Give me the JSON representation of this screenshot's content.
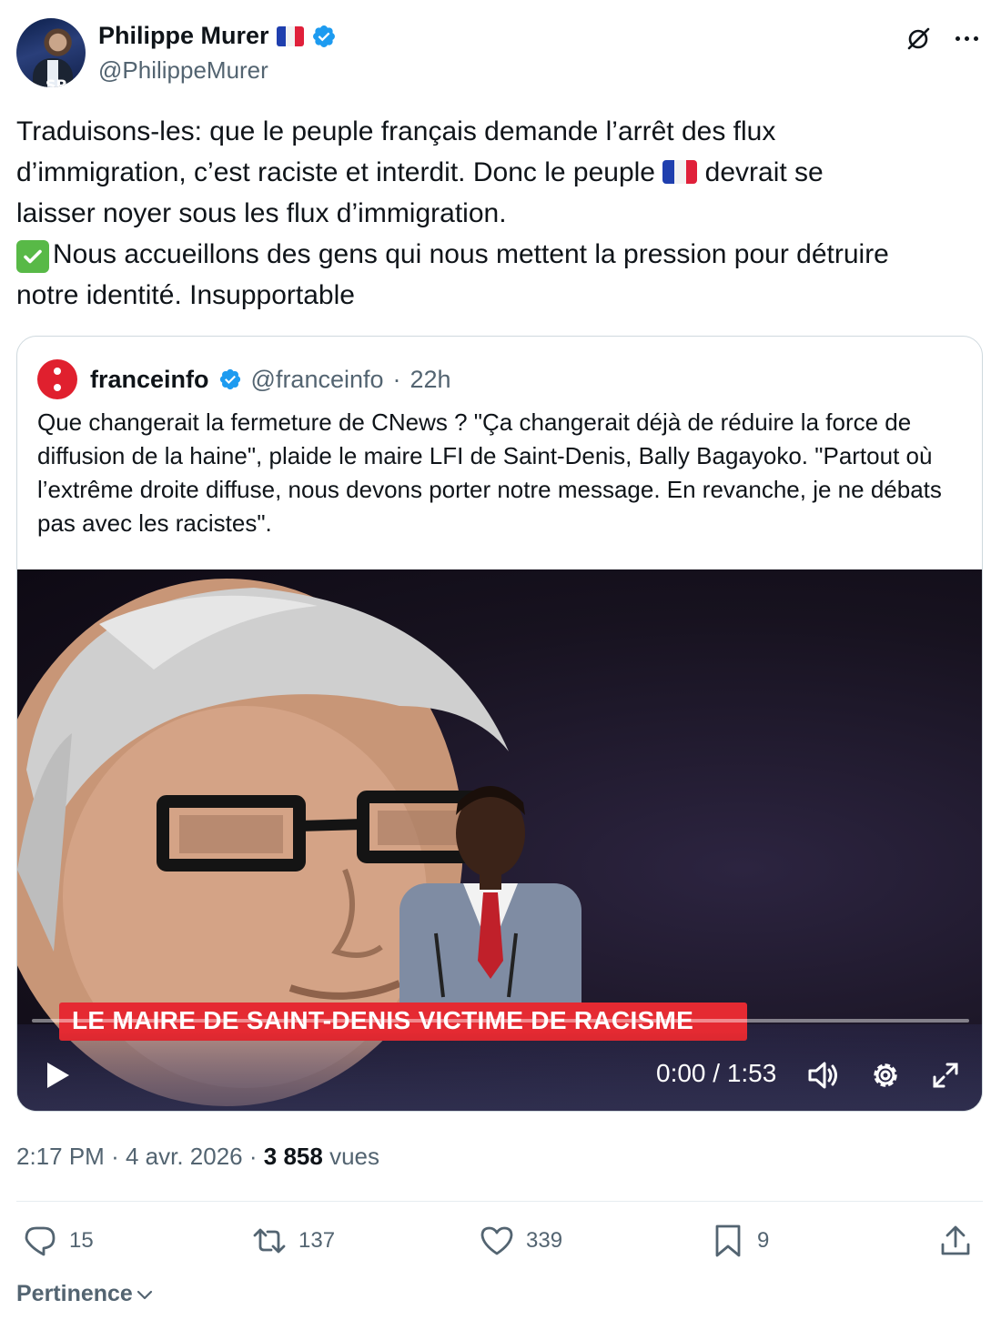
{
  "author": {
    "name": "Philippe Murer",
    "handle": "@PhilippeMurer",
    "avatar_label": "SP",
    "flag": "french-flag-emoji",
    "verified": true
  },
  "tweet": {
    "line1": "Traduisons-les: que le peuple français demande l’arrêt des flux",
    "line2a": "d’immigration, c’est raciste et interdit. Donc le peuple",
    "line2b": "devrait se",
    "line3": "laisser noyer sous les flux d’immigration.",
    "line4": "Nous accueillons des gens qui nous mettent la pression pour détruire",
    "line5": "notre identité. Insupportable"
  },
  "quote": {
    "name": "franceinfo",
    "handle": "@franceinfo",
    "separator": "·",
    "age": "22h",
    "text": "Que changerait la fermeture de CNews ? \"Ça changerait déjà de réduire la force de diffusion de la haine\", plaide le maire LFI de Saint-Denis, Bally Bagayoko. \"Partout où l’extrême droite diffuse, nous devons porter notre message. En revanche, je ne débats pas avec les racistes\".",
    "video": {
      "banner": "LE MAIRE DE SAINT-DENIS VICTIME DE RACISME",
      "time": "0:00 / 1:53",
      "progress": 0
    }
  },
  "meta": {
    "time": "2:17 PM",
    "dot1": "·",
    "date": "4 avr. 2026",
    "dot2": "·",
    "views": "3 858",
    "views_label": "vues"
  },
  "actions": {
    "replies": "15",
    "reposts": "137",
    "likes": "339",
    "bookmarks": "9"
  },
  "sort": {
    "label": "Pertinence"
  },
  "colors": {
    "text": "#0f1419",
    "secondary": "#536471",
    "verified": "#1d9bf0",
    "banner": "#e52a32",
    "franceinfo": "#e0202e"
  }
}
